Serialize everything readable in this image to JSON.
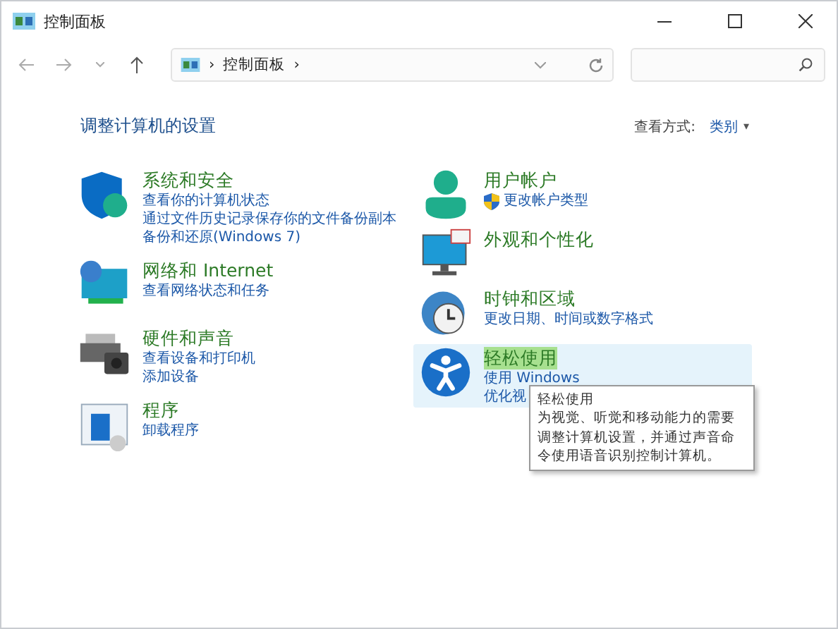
{
  "window": {
    "title": "控制面板"
  },
  "address_bar": {
    "path": "控制面板",
    "separator": "›"
  },
  "heading": "调整计算机的设置",
  "view_by": {
    "label": "查看方式:",
    "value": "类别",
    "caret": "▾"
  },
  "categories_left": [
    {
      "title": "系统和安全",
      "highlighted": false,
      "links": [
        "查看你的计算机状态",
        "通过文件历史记录保存你的文件备份副本",
        "备份和还原(Windows 7)"
      ]
    },
    {
      "title": "网络和 Internet",
      "highlighted": false,
      "links": [
        "查看网络状态和任务"
      ]
    },
    {
      "title": "硬件和声音",
      "highlighted": false,
      "links": [
        "查看设备和打印机",
        "添加设备"
      ]
    },
    {
      "title": "程序",
      "highlighted": false,
      "links": [
        "卸载程序"
      ]
    }
  ],
  "categories_right": [
    {
      "title": "用户帐户",
      "highlighted": false,
      "links": [
        "更改帐户类型"
      ]
    },
    {
      "title": "外观和个性化",
      "highlighted": false
    },
    {
      "title": "时钟和区域",
      "highlighted": false,
      "links": [
        "更改日期、时间或数字格式"
      ]
    },
    {
      "title": "轻松使用",
      "highlighted": true,
      "links": [
        "使用 Windows",
        "优化视"
      ]
    }
  ],
  "tooltip": {
    "title": "轻松使用",
    "text": "为视觉、听觉和移动能力的需要调整计算机设置，并通过声音命令使用语音识别控制计算机。"
  }
}
